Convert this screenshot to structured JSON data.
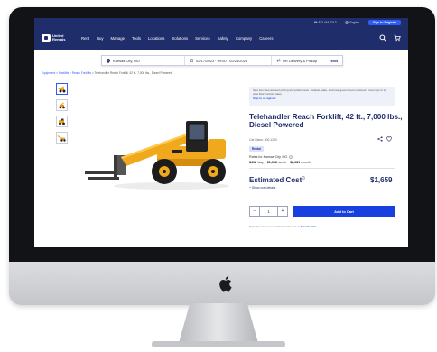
{
  "utility_bar": {
    "phone": "☎ 833-444-2213",
    "language": "English",
    "signin": "Sign in / Register"
  },
  "brand": {
    "name": "United\nRentals"
  },
  "nav": {
    "items": [
      "Rent",
      "Buy",
      "Manage",
      "Tools",
      "Locations",
      "Solutions",
      "Services",
      "Safety",
      "Company",
      "Careers"
    ]
  },
  "search": {
    "location": "Kansas City, MO",
    "dates": "02/17/2023 · 09:00 · 02/24/2023",
    "delivery": "UR Delivery & Pickup",
    "edit": "Edit"
  },
  "breadcrumb": {
    "items": [
      "Equipment",
      "Forklifts",
      "Reach Forklifts"
    ],
    "current": "Telehandler Reach Forklift, 42 ft., 7,000 lbs., Diesel Powered"
  },
  "signin_prompt": {
    "text": "Sign into view account pricing and preferences. Federal, state, and local government customers must sign in to view their contract rates.",
    "link": "Sign in or register"
  },
  "product": {
    "title": "Telehandler Reach Forklift, 42 ft., 7,000 lbs., Diesel Powered",
    "cat_class": "Cat Class: 300-1260",
    "tag": "Rental"
  },
  "rates": {
    "label": "Rates for Kansas City, MO",
    "day": "$492",
    "day_unit": "/day",
    "week": "$1,368",
    "week_unit": "/week",
    "month": "$2,681",
    "month_unit": "/month"
  },
  "estimate": {
    "label": "Estimated Cost",
    "value": "$1,659",
    "details_link": "+ Show cost details"
  },
  "cart": {
    "qty_minus": "−",
    "qty": "1",
    "qty_plus": "+",
    "add_label": "Add to Cart"
  },
  "footnote": {
    "text": "Typically rented more? Call United Rentals at",
    "phone": "800-000-0000"
  },
  "colors": {
    "navy": "#1f2d6b",
    "accent_blue": "#1a3fe0",
    "machine_yellow": "#f0a81c"
  }
}
